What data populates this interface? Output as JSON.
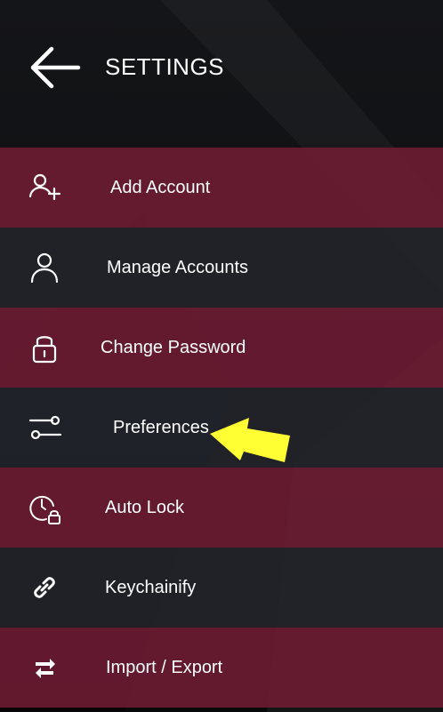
{
  "header": {
    "title": "SETTINGS",
    "back_icon": "arrow-left-icon"
  },
  "menu": {
    "items": [
      {
        "label": "Add Account",
        "icon": "user-plus-icon"
      },
      {
        "label": "Manage Accounts",
        "icon": "user-icon"
      },
      {
        "label": "Change Password",
        "icon": "lock-icon"
      },
      {
        "label": "Preferences",
        "icon": "sliders-icon"
      },
      {
        "label": "Auto Lock",
        "icon": "clock-lock-icon"
      },
      {
        "label": "Keychainify",
        "icon": "link-icon"
      },
      {
        "label": "Import / Export",
        "icon": "swap-arrows-icon"
      }
    ]
  },
  "colors": {
    "row_red": "#701c34",
    "row_dark": "#22252b",
    "text": "#ffffff",
    "annotation_arrow": "#ffff33"
  }
}
